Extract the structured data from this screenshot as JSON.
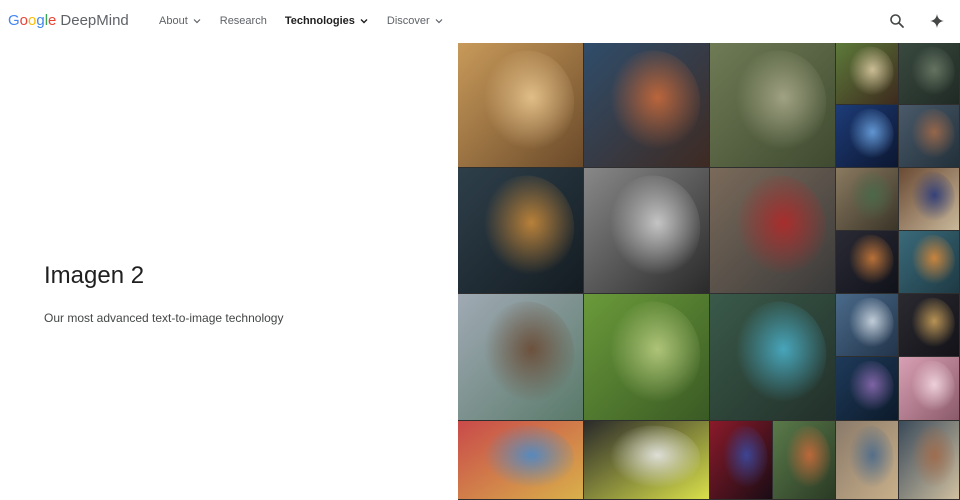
{
  "header": {
    "logo": {
      "google_letters": [
        {
          "ch": "G",
          "color": "#4285F4"
        },
        {
          "ch": "o",
          "color": "#EA4335"
        },
        {
          "ch": "o",
          "color": "#FBBC05"
        },
        {
          "ch": "g",
          "color": "#4285F4"
        },
        {
          "ch": "l",
          "color": "#34A853"
        },
        {
          "ch": "e",
          "color": "#EA4335"
        }
      ],
      "product": "DeepMind"
    },
    "nav": [
      {
        "label": "About",
        "has_dropdown": true,
        "active": false
      },
      {
        "label": "Research",
        "has_dropdown": false,
        "active": false
      },
      {
        "label": "Technologies",
        "has_dropdown": true,
        "active": true
      },
      {
        "label": "Discover",
        "has_dropdown": true,
        "active": false
      }
    ],
    "icons": [
      "search-icon",
      "sparkle-icon"
    ]
  },
  "hero": {
    "title": "Imagen 2",
    "subtitle": "Our most advanced text-to-image technology"
  },
  "mosaic": {
    "tiles": [
      {
        "subject": "giraffes-and-zebra",
        "palette": [
          "#c89a5a",
          "#e8c58e",
          "#6b4a2a"
        ]
      },
      {
        "subject": "woman-portrait-colorful",
        "palette": [
          "#2f4d6b",
          "#c96a3a",
          "#3e2a22"
        ]
      },
      {
        "subject": "armored-warrior-flag",
        "palette": [
          "#6f7b55",
          "#a8a98a",
          "#3f4a30"
        ]
      },
      {
        "subject": "smiling-woman-portrait",
        "palette": [
          "#5d7a3a",
          "#d9c9a0",
          "#3d2a1e"
        ]
      },
      {
        "subject": "plant-and-chair",
        "palette": [
          "#3a4a40",
          "#6a7a66",
          "#1f2a24"
        ]
      },
      {
        "subject": "concert-crowd-blue",
        "palette": [
          "#1d3c78",
          "#6aa2e0",
          "#0c1630"
        ]
      },
      {
        "subject": "city-street-vertical",
        "palette": [
          "#4a5a6a",
          "#a06a4a",
          "#22303a"
        ]
      },
      {
        "subject": "alley-night-lanterns",
        "palette": [
          "#2e3f4a",
          "#c98a3a",
          "#141c22"
        ]
      },
      {
        "subject": "elderly-couple-bw",
        "palette": [
          "#888888",
          "#d0d0d0",
          "#2a2a2a"
        ]
      },
      {
        "subject": "hand-waving-street",
        "palette": [
          "#7a6a5a",
          "#b02a2a",
          "#3a3a3a"
        ]
      },
      {
        "subject": "arched-room-interior",
        "palette": [
          "#8a7a60",
          "#4a6a4a",
          "#3a3428"
        ]
      },
      {
        "subject": "bowl-of-blueberries",
        "palette": [
          "#6a4a34",
          "#2a3a7a",
          "#c9b89a"
        ]
      },
      {
        "subject": "night-street-lamps",
        "palette": [
          "#2a2a34",
          "#c97a3a",
          "#10121a"
        ]
      },
      {
        "subject": "cartoon-viking-fox",
        "palette": [
          "#3a6a7a",
          "#d98a3a",
          "#1e3a44"
        ]
      },
      {
        "subject": "young-man-portrait",
        "palette": [
          "#a0aab4",
          "#6a4a34",
          "#5a7a6a"
        ]
      },
      {
        "subject": "green-hills-horses",
        "palette": [
          "#6a9a3a",
          "#b8cc80",
          "#3a5a24"
        ]
      },
      {
        "subject": "cyclists-race",
        "palette": [
          "#3a5a4a",
          "#4ab0c9",
          "#22302a"
        ]
      },
      {
        "subject": "clouds-over-lake",
        "palette": [
          "#4a6a8a",
          "#d0dae4",
          "#22344a"
        ]
      },
      {
        "subject": "village-house-dusk",
        "palette": [
          "#2a2a30",
          "#c9a05a",
          "#121218"
        ]
      },
      {
        "subject": "jellyfish-underwater",
        "palette": [
          "#1e3a5a",
          "#8a6ab0",
          "#0c1a2a"
        ]
      },
      {
        "subject": "cherry-blossoms",
        "palette": [
          "#d9a0b4",
          "#f4d8e2",
          "#8a5a6a"
        ]
      },
      {
        "subject": "colorful-city-painting",
        "palette": [
          "#c94a4a",
          "#4a8ac9",
          "#d9b04a"
        ]
      },
      {
        "subject": "sneaker-closeup",
        "palette": [
          "#2a2a2a",
          "#e8e8e8",
          "#d9e04a"
        ]
      },
      {
        "subject": "red-face-neon",
        "palette": [
          "#8a1a2a",
          "#3a4aa0",
          "#1a0c14"
        ]
      },
      {
        "subject": "bird-on-branch",
        "palette": [
          "#5a7a4a",
          "#c96a3a",
          "#2a3a24"
        ]
      },
      {
        "subject": "small-collage-a",
        "palette": [
          "#8a7a6a",
          "#4a6a8a",
          "#c9b08a"
        ]
      },
      {
        "subject": "small-collage-b",
        "palette": [
          "#3a4a5a",
          "#a06a4a",
          "#d0c0a0"
        ]
      }
    ]
  }
}
